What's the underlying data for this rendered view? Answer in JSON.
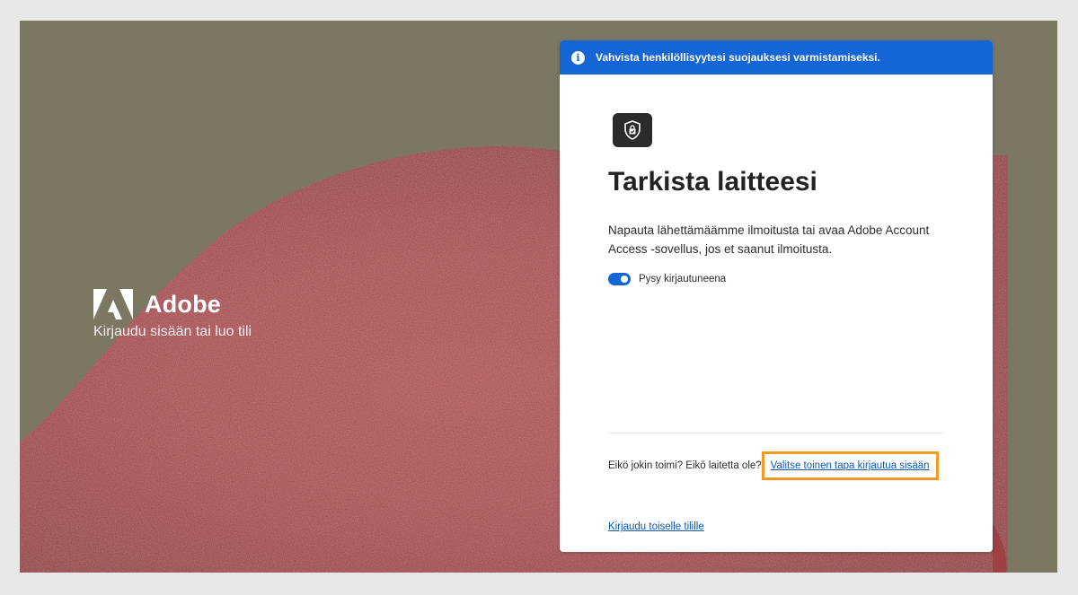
{
  "brand": {
    "name": "Adobe",
    "subtitle": "Kirjaudu sisään tai luo tili"
  },
  "banner": {
    "text": "Vahvista henkilöllisyytesi suojauksesi varmistamiseksi.",
    "icon": "info-icon"
  },
  "card": {
    "icon": "shield-lock-icon",
    "title": "Tarkista laitteesi",
    "description": "Napauta lähettämäämme ilmoitusta tai avaa Adobe Account Access -sovellus, jos et saanut ilmoitusta.",
    "stay_signed_in": {
      "label": "Pysy kirjautuneena",
      "checked": true
    },
    "help_text": "Eikö jokin toimi? Eikö laitetta ole?",
    "alt_signin_link": "Valitse toinen tapa kirjautua sisään",
    "other_account_link": "Kirjaudu toiselle tilille"
  },
  "colors": {
    "accent": "#1466d6",
    "highlight": "#f39a26",
    "background": "#7c7763"
  }
}
